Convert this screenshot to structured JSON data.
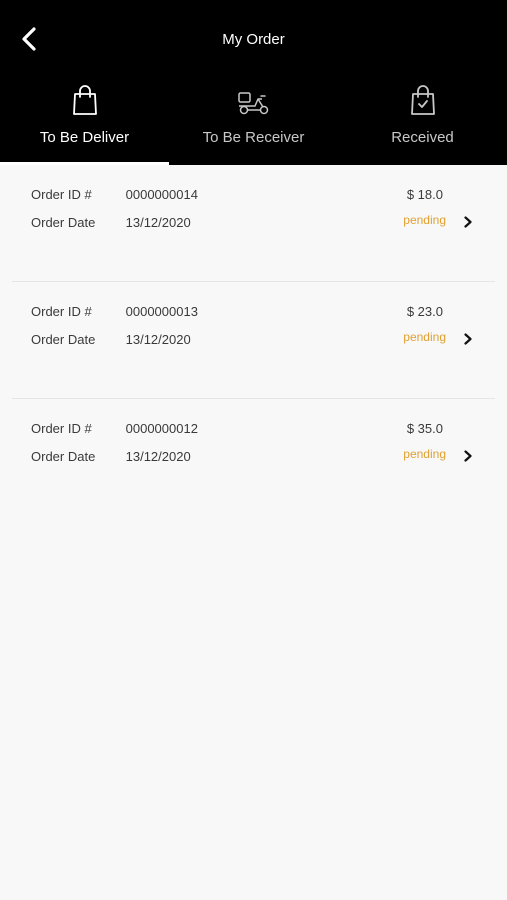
{
  "header": {
    "title": "My Order",
    "back_icon": "chevron-left-icon"
  },
  "tabs": [
    {
      "label": "To Be Deliver",
      "icon": "shopping-bag-icon",
      "active": true
    },
    {
      "label": "To Be Receiver",
      "icon": "delivery-scooter-icon",
      "active": false
    },
    {
      "label": "Received",
      "icon": "bag-check-icon",
      "active": false
    }
  ],
  "orders": [
    {
      "id_label": "Order ID #",
      "id": "0000000014",
      "date_label": "Order Date",
      "date": "13/12/2020",
      "price": "$ 18.0",
      "status": "pending"
    },
    {
      "id_label": "Order ID #",
      "id": "0000000013",
      "date_label": "Order Date",
      "date": "13/12/2020",
      "price": "$ 23.0",
      "status": "pending"
    },
    {
      "id_label": "Order ID #",
      "id": "0000000012",
      "date_label": "Order Date",
      "date": "13/12/2020",
      "price": "$ 35.0",
      "status": "pending"
    }
  ],
  "colors": {
    "header_bg": "#000000",
    "status_pending": "#e0a030",
    "page_bg": "#f8f8f8"
  }
}
